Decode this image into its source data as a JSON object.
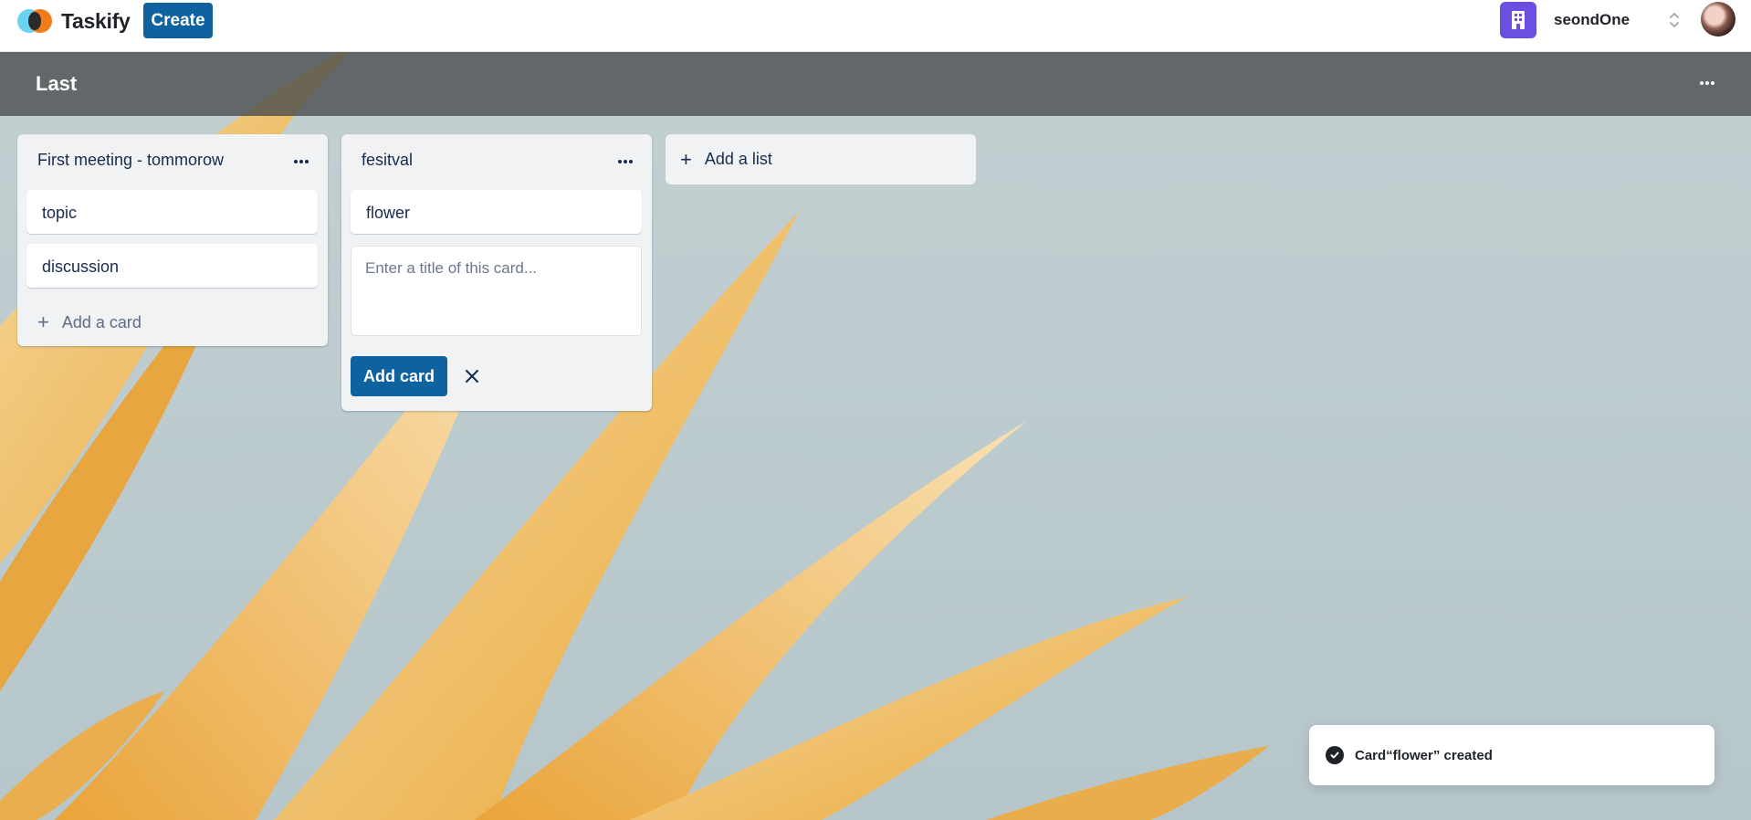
{
  "navbar": {
    "brand": "Taskify",
    "create_label": "Create",
    "organization": "seondOne"
  },
  "board": {
    "title": "Last"
  },
  "lists": [
    {
      "title": "First meeting - tommorow",
      "cards": [
        "topic",
        "discussion"
      ],
      "add_card_label": "Add a card"
    },
    {
      "title": "fesitval",
      "cards": [
        "flower"
      ],
      "new_card_placeholder": "Enter a title of this card...",
      "add_card_button": "Add card"
    }
  ],
  "add_list_label": "Add a list",
  "toast": {
    "message": "Card“flower” created"
  },
  "colors": {
    "primary": "#0f62a0",
    "org_icon": "#6c4fe0",
    "list_bg": "#f1f2f4"
  },
  "icons": [
    "logo-icon",
    "building-icon",
    "chevron-updown-icon",
    "more-horizontal-icon",
    "plus-icon",
    "close-icon",
    "check-circle-icon"
  ]
}
